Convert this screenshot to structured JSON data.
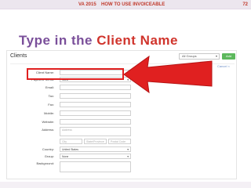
{
  "header": {
    "left": "VA 2015",
    "middle": "HOW TO USE INVOICEABLE",
    "page_number": "72"
  },
  "slide_title": {
    "part1": "Type in the",
    "part2": "Client Name"
  },
  "app": {
    "page_title": "Clients",
    "group_select": {
      "value": "All Groups",
      "caret": "▾"
    },
    "add_client_label": "Add Client",
    "cancel_label": "Cancel ×"
  },
  "form": {
    "client_name_label": "Client Name:",
    "client_name_value": "",
    "payment_terms_label": "Payment Terms:",
    "payment_terms_value": "None",
    "email_label": "Email:",
    "tax_label": "Tax:",
    "fax_label": "Fax:",
    "mobile_label": "Mobile:",
    "website_label": "Website:",
    "address_label": "Address:",
    "address_placeholder": "Address",
    "city_placeholder": "City",
    "state_placeholder": "State/Province",
    "postal_placeholder": "Postal Code",
    "country_label": "Country:",
    "country_value": "United States",
    "group_label": "Group:",
    "group_value": "None",
    "background_label": "Background:"
  },
  "colors": {
    "title_purple": "#7a4f9a",
    "title_red": "#d0342c",
    "highlight_red": "#e02020",
    "button_green": "#5cb85c"
  }
}
